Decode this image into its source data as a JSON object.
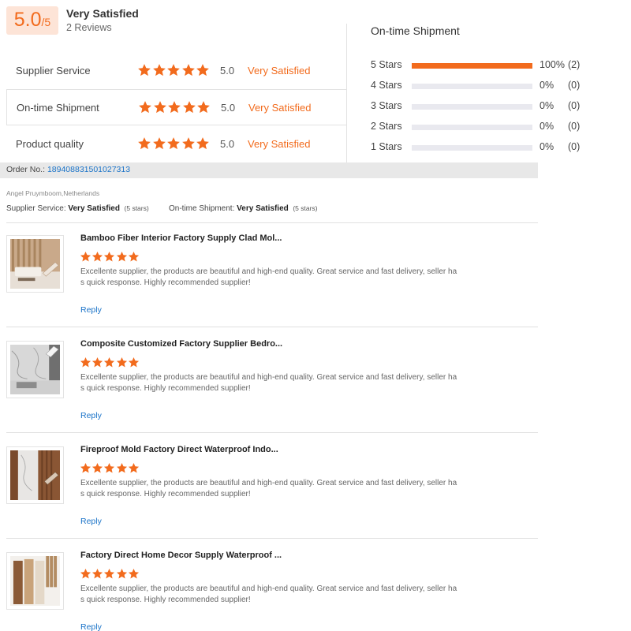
{
  "summary": {
    "score": "5.0",
    "score_suffix": "/5",
    "title": "Very Satisfied",
    "reviews": "2 Reviews"
  },
  "ratings": [
    {
      "label": "Supplier Service",
      "stars": 5,
      "score": "5.0",
      "text": "Very Satisfied"
    },
    {
      "label": "On-time Shipment",
      "stars": 5,
      "score": "5.0",
      "text": "Very Satisfied"
    },
    {
      "label": "Product quality",
      "stars": 5,
      "score": "5.0",
      "text": "Very Satisfied"
    }
  ],
  "distribution": {
    "title": "On-time Shipment",
    "rows": [
      {
        "label": "5  Stars",
        "fraction": 1.0,
        "pct": "100%",
        "count": "(2)"
      },
      {
        "label": "4  Stars",
        "fraction": 0,
        "pct": "0%",
        "count": "(0)"
      },
      {
        "label": "3  Stars",
        "fraction": 0,
        "pct": "0%",
        "count": "(0)"
      },
      {
        "label": "2  Stars",
        "fraction": 0,
        "pct": "0%",
        "count": "(0)"
      },
      {
        "label": "1  Stars",
        "fraction": 0,
        "pct": "0%",
        "count": "(0)"
      }
    ]
  },
  "order": {
    "label": "Order No.:",
    "number": "189408831501027313"
  },
  "review": {
    "reviewer": "Angel Pruymboom,Netherlands",
    "service_label": "Supplier Service:",
    "service_value": "Very Satisfied",
    "service_stars": "(5 stars)",
    "shipment_label": "On-time Shipment:",
    "shipment_value": "Very Satisfied",
    "shipment_stars": "(5 stars)"
  },
  "colors": {
    "accent": "#f26b1d",
    "link": "#1a73c8",
    "score_bg": "#fde4d7"
  },
  "products": [
    {
      "title": "Bamboo Fiber Interior Factory Supply Clad Mol...",
      "stars": 5,
      "text": "Excellente supplier, the products are beautiful and high-end quality. Great service and fast delivery, seller has quick response. Highly recommended supplier!",
      "reply": "Reply",
      "image": "living-room-wall-panels"
    },
    {
      "title": "Composite Customized Factory Supplier Bedro...",
      "stars": 5,
      "text": "Excellente supplier, the products are beautiful and high-end quality. Great service and fast delivery, seller has quick response. Highly recommended supplier!",
      "reply": "Reply",
      "image": "marble-wall-panels"
    },
    {
      "title": "Fireproof Mold Factory Direct Waterproof Indo...",
      "stars": 5,
      "text": "Excellente supplier, the products are beautiful and high-end quality. Great service and fast delivery, seller has quick response. Highly recommended supplier!",
      "reply": "Reply",
      "image": "wood-marble-panels"
    },
    {
      "title": "Factory Direct Home Decor Supply Waterproof ...",
      "stars": 5,
      "text": "Excellente supplier, the products are beautiful and high-end quality. Great service and fast delivery, seller has quick response. Highly recommended supplier!",
      "reply": "Reply",
      "image": "fluted-wood-panels"
    }
  ]
}
